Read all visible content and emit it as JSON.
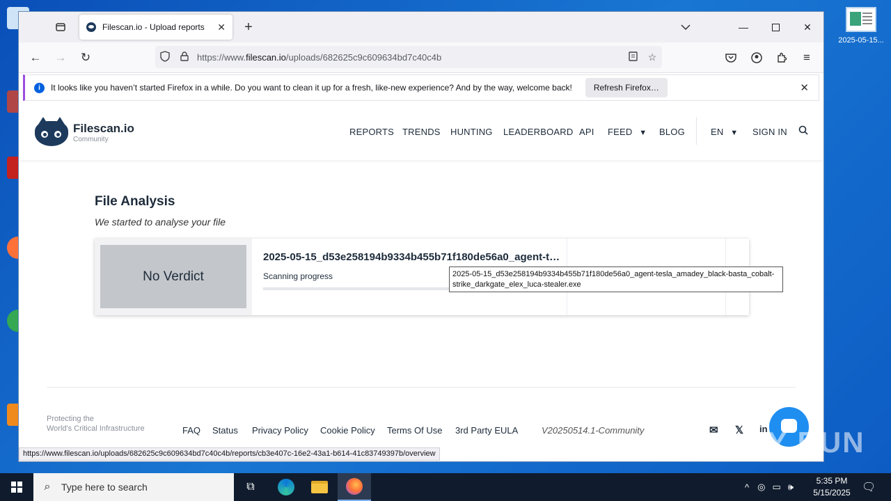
{
  "desktop": {
    "right_icon_label": "2025-05-15..."
  },
  "browser": {
    "tab_title": "Filescan.io - Upload reports",
    "url_prefix": "https://www.",
    "url_host": "filescan.io",
    "url_path": "/uploads/682625c9c609634bd7c40c4b",
    "notification": {
      "text": "It looks like you haven’t started Firefox in a while. Do you want to clean it up for a fresh, like-new experience? And by the way, welcome back!",
      "button": "Refresh Firefox…"
    },
    "status_url": "https://www.filescan.io/uploads/682625c9c609634bd7c40c4b/reports/cb3e407c-16e2-43a1-b614-41c83749397b/overview"
  },
  "site": {
    "logo_name": "Filescan.io",
    "logo_sub": "Community",
    "nav": {
      "reports": "REPORTS",
      "trends": "TRENDS",
      "hunting": "HUNTING",
      "leaderboard": "LEADERBOARD",
      "api": "API",
      "feed": "FEED",
      "blog": "BLOG",
      "lang": "EN",
      "signin": "SIGN IN"
    },
    "title": "File Analysis",
    "subtitle": "We started to analyse your file",
    "card": {
      "verdict": "No Verdict",
      "filename": "2025-05-15_d53e258194b9334b455b71f180de56a0_agent-tesla_amadey_black-basta_cobalt-strike_darkgate_elex_luca-stealer.exe",
      "progress_label": "Scanning progress",
      "progress": 0
    },
    "tooltip": "2025-05-15_d53e258194b9334b455b71f180de56a0_agent-tesla_amadey_black-basta_cobalt-strike_darkgate_elex_luca-stealer.exe",
    "footer": {
      "tagline_1": "Protecting the",
      "tagline_2": "World's Critical Infrastructure",
      "links": {
        "faq": "FAQ",
        "status": "Status",
        "privacy": "Privacy Policy",
        "cookie": "Cookie Policy",
        "terms": "Terms Of Use",
        "eula": "3rd Party EULA"
      },
      "version": "V20250514.1-Community"
    }
  },
  "watermark": "ANY RUN",
  "taskbar": {
    "search_placeholder": "Type here to search",
    "time": "5:35 PM",
    "date": "5/15/2025"
  },
  "colors": {
    "brand_navy": "#1d3a5c",
    "firefox_purple": "#9b4de0",
    "chat_blue": "#1f8ef1"
  }
}
